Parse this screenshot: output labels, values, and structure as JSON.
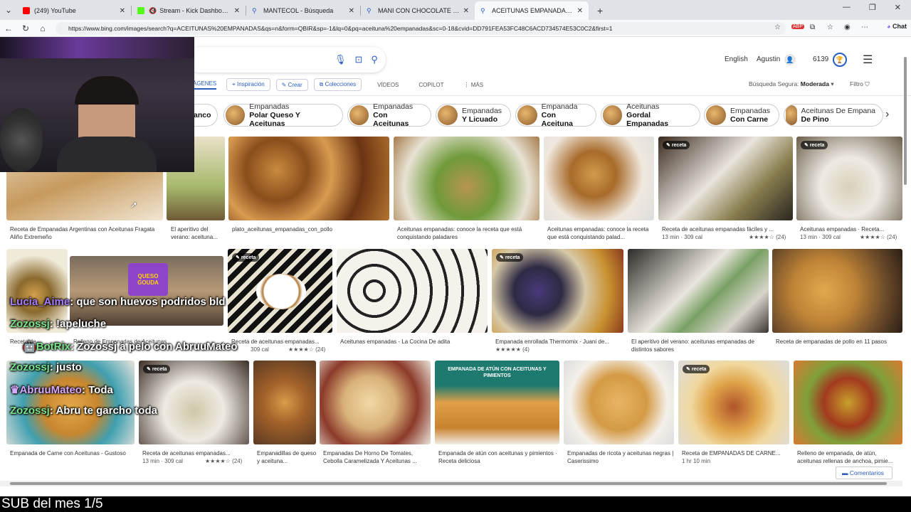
{
  "browser": {
    "tabs": [
      {
        "label": "(249) YouTube",
        "color": "#ff0000"
      },
      {
        "label": "Stream - Kick Dashboard",
        "color": "#53fc18"
      },
      {
        "label": "MANTECOL - Búsqueda",
        "color": "#2a5dbf"
      },
      {
        "label": "MANI CON CHOCOLATE - Búsque",
        "color": "#2a5dbf"
      },
      {
        "label": "ACEITUNAS EMPANADAS - Búsqu",
        "color": "#2a5dbf"
      }
    ],
    "url": "https://www.bing.com/images/search?q=ACEITUNAS%20EMPANADAS&qs=n&form=QBIR&sp=-1&lq=0&pq=aceituna%20empanadas&sc=0-18&cvid=DD791FEA53FC48C6ACD734574E53C0C2&first=1",
    "chat_label": "Chat"
  },
  "header": {
    "language": "English",
    "user": "Agustin",
    "points": "6139",
    "nav": {
      "images": "IMÁGENES",
      "inspiracion": "Inspiración",
      "crear": "Crear",
      "colecciones": "Colecciones",
      "videos": "VÍDEOS",
      "copilot": "COPILOT",
      "mas": "MÁS"
    },
    "safe_label": "Búsqueda Segura:",
    "safe_value": "Moderada",
    "filter": "Filtro"
  },
  "chips": [
    {
      "top": "",
      "bottom": "anco"
    },
    {
      "top": "Empanadas",
      "bottom": "Polar Queso Y Aceitunas"
    },
    {
      "top": "Empanadas",
      "bottom": "Con Aceitunas"
    },
    {
      "top": "Empanadas",
      "bottom": "Y Licuado"
    },
    {
      "top": "Empanada",
      "bottom": "Con Aceituna"
    },
    {
      "top": "Aceitunas",
      "bottom": "Gordal Empanadas"
    },
    {
      "top": "Empanadas",
      "bottom": "Con Carne"
    },
    {
      "top": "Aceitunas De Empana",
      "bottom": "De Pino"
    }
  ],
  "results": {
    "row1": [
      {
        "caption": "Receta de Empanadas Argentinas con Aceitunas Fragata Aliño Extremeño"
      },
      {
        "caption": "El aperitivo del verano: aceituna..."
      },
      {
        "caption": "plato_aceitunas_empanadas_con_pollo"
      },
      {
        "caption": "Aceitunas empanadas: conoce la receta que está conquistando paladares"
      },
      {
        "caption": "Aceitunas empanadas: conoce la receta que está conquistando palad..."
      },
      {
        "caption": "Receta de aceitunas empanadas fáciles y ...",
        "meta": "13 min · 309 cal",
        "rating": "★★★★☆ (24)"
      },
      {
        "caption": "Aceitunas empanadas · Receta...",
        "meta": "13 min · 309 cal",
        "rating": "★★★★☆ (24)"
      }
    ],
    "row2": [
      {
        "caption": "Receta de..."
      },
      {
        "caption": "Relleno de Empanadas de Aceitunas"
      },
      {
        "caption": "Receta de aceitunas empanadas...",
        "meta": "309 cal",
        "rating": "★★★★☆ (24)"
      },
      {
        "caption": "Aceitunas empanadas - La Cocina De adita"
      },
      {
        "caption": "Empanada enrollada Thermomix - Juani de...",
        "rating": "★★★★★ (4)"
      },
      {
        "caption": "El aperitivo del verano: aceitunas empanadas de distintos sabores"
      },
      {
        "caption": "Receta de empanadas de pollo en 11 pasos"
      }
    ],
    "row3": [
      {
        "caption": "Empanada de Carne con Aceitunas - Gustoso"
      },
      {
        "caption": "Receta de aceitunas empanadas...",
        "meta": "13 min · 309 cal",
        "rating": "★★★★☆ (24)"
      },
      {
        "caption": "Empanadillas de queso y aceituna..."
      },
      {
        "caption": "Empanadas De Horno De Tomates, Cebolla Caramelizada Y Aceitunas ..."
      },
      {
        "caption": "Empanada de atún con aceitunas y pimientos · Receta deliciosa"
      },
      {
        "caption": "Empanadas de ricota y aceitunas negras | Caserissimo"
      },
      {
        "caption": "Receta de EMPANADAS DE CARNE...",
        "meta": "1 hr 10 min"
      },
      {
        "caption": "Relleno de empanada, de atún, aceitunas rellenas de anchoa, pimie..."
      }
    ],
    "badge": "receta",
    "overlay_text": {
      "queso": "QUESO GOUDA",
      "atun": "EMPANADA DE ATÚN CON ACEITUNAS Y PIMIENTOS"
    }
  },
  "chat": [
    {
      "user": "Lucia_Aime",
      "user_color": "#a87cff",
      "text": "que son huevos podridos bld"
    },
    {
      "user": "Zozossj",
      "user_color": "#7be38b",
      "text": "!apeluche"
    },
    {
      "user": "BotRix",
      "user_color": "#7be38b",
      "text": "Zozossj a pelo con AbruuMateo"
    },
    {
      "user": "Zozossj",
      "user_color": "#7be38b",
      "text": "justo"
    },
    {
      "user": "AbruuMateo",
      "user_color": "#d6a8ff",
      "text": "Toda"
    },
    {
      "user": "Zozossj",
      "user_color": "#7be38b",
      "text": "Abru te garcho toda"
    }
  ],
  "comentarios": "Comentarios",
  "subtitle": "SUB del mes 1/5"
}
